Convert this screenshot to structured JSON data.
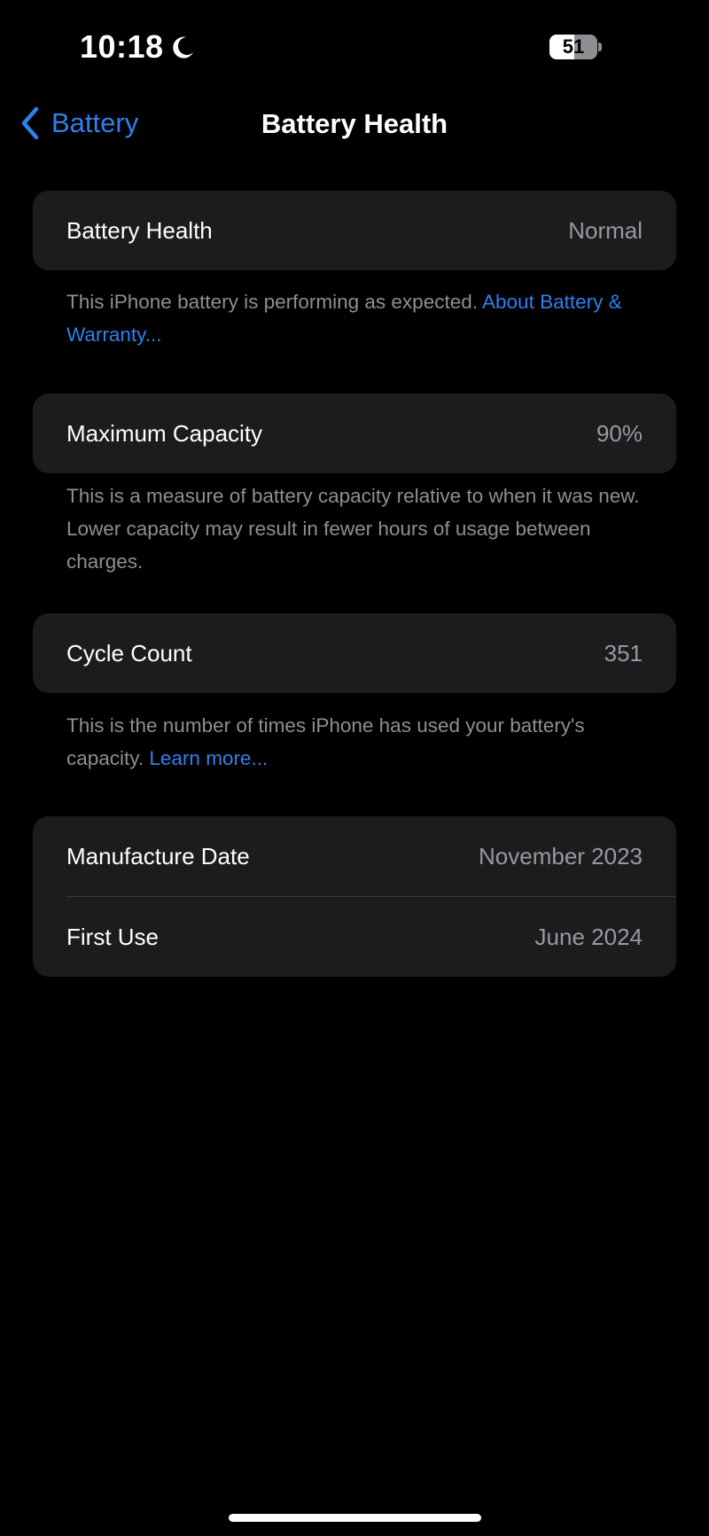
{
  "status_bar": {
    "time": "10:18",
    "battery_level": "51",
    "battery_fraction": 0.51,
    "focus_icon": "moon-icon"
  },
  "nav": {
    "back_label": "Battery",
    "back_icon": "chevron-left-icon",
    "title": "Battery Health"
  },
  "sections": {
    "health": {
      "label": "Battery Health",
      "value": "Normal",
      "footnote": "This iPhone battery is performing as expected.",
      "link": "About Battery & Warranty..."
    },
    "capacity": {
      "label": "Maximum Capacity",
      "value": "90%",
      "footnote": "This is a measure of battery capacity relative to when it was new. Lower capacity may result in fewer hours of usage between charges."
    },
    "cycles": {
      "label": "Cycle Count",
      "value": "351",
      "footnote": "This is the number of times iPhone has used your battery's capacity.",
      "link": "Learn more..."
    },
    "dates": {
      "manufacture_label": "Manufacture Date",
      "manufacture_value": "November 2023",
      "first_use_label": "First Use",
      "first_use_value": "June 2024"
    }
  },
  "colors": {
    "background": "#000000",
    "card": "#1c1c1e",
    "accent": "#2f80ed",
    "secondary_text": "#8e8e93"
  }
}
